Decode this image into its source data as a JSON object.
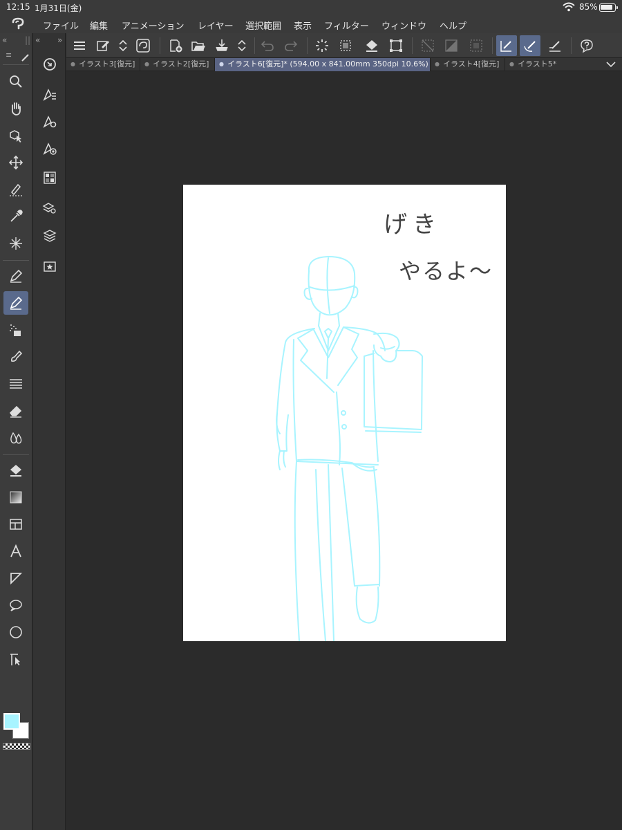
{
  "status": {
    "time": "12:15",
    "date": "1月31日(金)",
    "battery": "85%"
  },
  "menu": [
    "ファイル",
    "編集",
    "アニメーション",
    "レイヤー",
    "選択範囲",
    "表示",
    "フィルター",
    "ウィンドウ",
    "ヘルプ"
  ],
  "panel": {
    "collapse_left": "«",
    "collapse_right": "»",
    "grip": "||",
    "tab_menu": "≡"
  },
  "tabs": [
    {
      "label": "イラスト3[復元]"
    },
    {
      "label": "イラスト2[復元]"
    },
    {
      "label": "イラスト6[復元]* (594.00 x 841.00mm 350dpi 10.6%)"
    },
    {
      "label": "イラスト4[復元]"
    },
    {
      "label": "イラスト5*"
    }
  ],
  "canvas": {
    "handwriting_line1": "げき",
    "handwriting_line2": "やるよ〜",
    "sketch_color": "#a8f4ff"
  },
  "colors": {
    "main": "#a8f4ff",
    "sub": "#ffffff",
    "accent": "#5a6a8c"
  },
  "icons": {
    "left_tools": [
      "zoom-icon",
      "hand-icon",
      "object-select-icon",
      "move-icon",
      "lasso-select-icon",
      "eyedropper-icon",
      "auto-select-icon",
      "pen-icon",
      "pencil-icon",
      "airbrush-icon",
      "brush-icon",
      "hatching-icon",
      "eraser-icon",
      "blend-icon",
      "fill-icon",
      "gradient-icon",
      "frame-border-icon",
      "text-icon",
      "ruler-icon",
      "balloon-icon",
      "figure-icon",
      "correct-line-icon"
    ]
  }
}
